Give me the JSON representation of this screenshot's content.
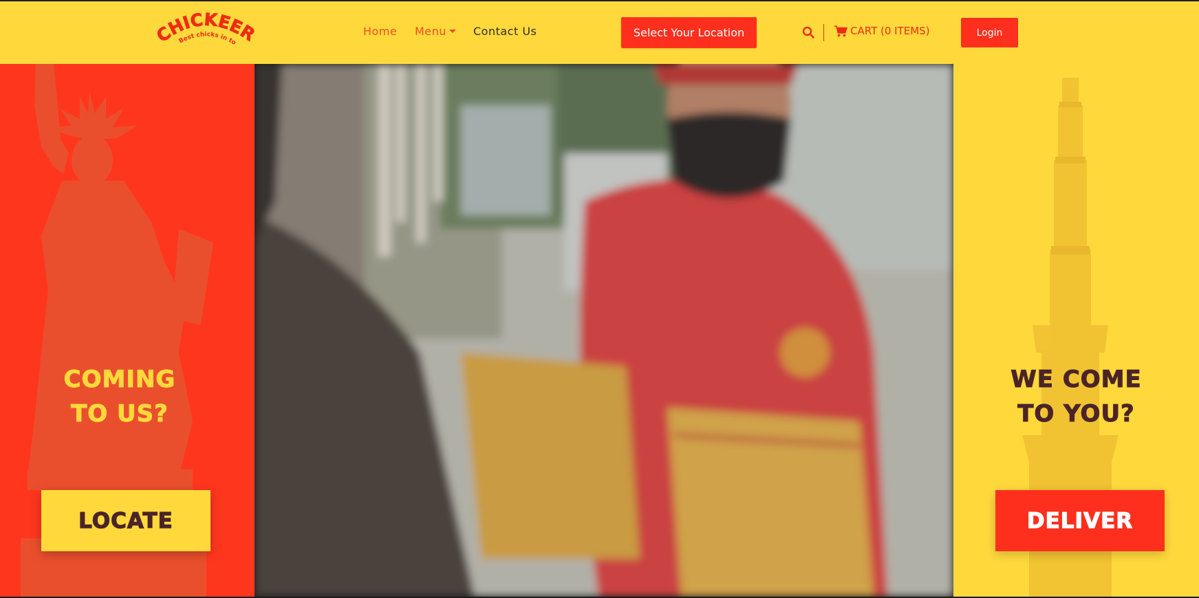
{
  "brand": {
    "name": "CHICKEERA!",
    "tagline": "Best chicks in town",
    "colors": {
      "yellow": "#ffd93c",
      "red": "#ff2f1d",
      "brown": "#4b2428"
    }
  },
  "nav": {
    "home": "Home",
    "menu": "Menu",
    "contact": "Contact Us"
  },
  "header": {
    "location_button": "Select Your Location",
    "search_icon": "search-icon",
    "cart_label": "CART (0 ITEMS)",
    "login_button": "Login"
  },
  "left": {
    "title_line1": "COMING",
    "title_line2": "TO US?",
    "button": "LOCATE"
  },
  "right": {
    "title_line1": "WE COME",
    "title_line2": "TO YOU?",
    "button": "DELIVER"
  }
}
